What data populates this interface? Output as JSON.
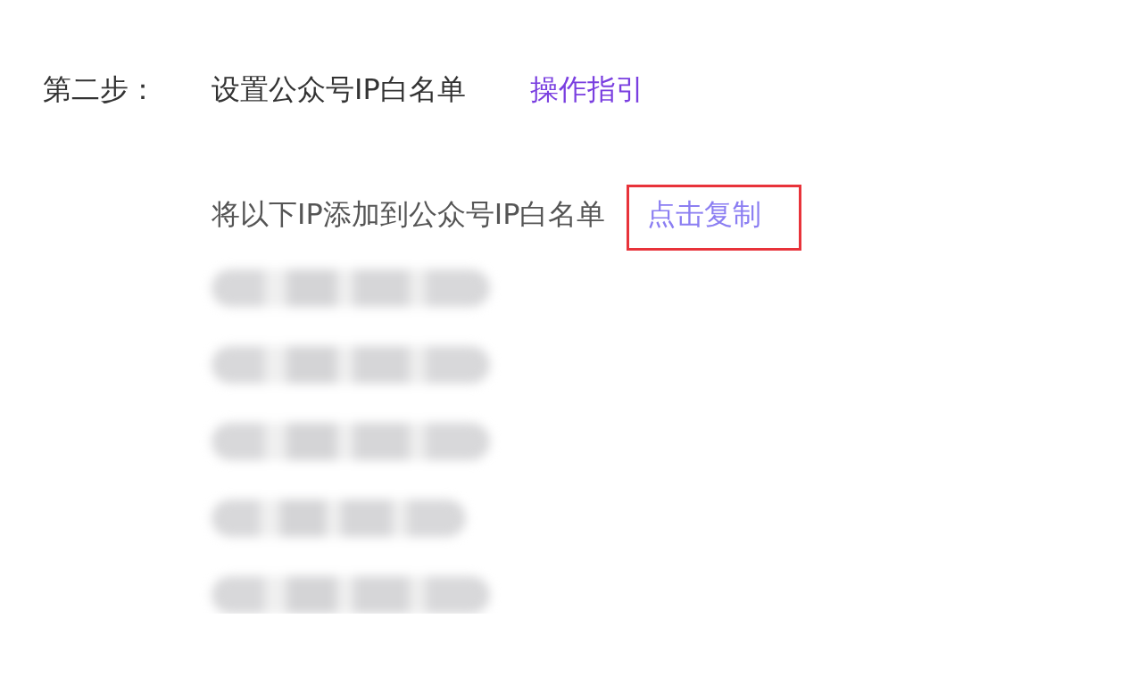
{
  "step": {
    "label": "第二步：",
    "title": "设置公众号IP白名单",
    "guide_link": "操作指引"
  },
  "instruction": {
    "text": "将以下IP添加到公众号IP白名单",
    "copy_link": "点击复制",
    "highlighted": true
  },
  "ip_list": [
    {
      "kind": "blurred"
    },
    {
      "kind": "blurred"
    },
    {
      "kind": "blurred"
    },
    {
      "kind": "blurred"
    },
    {
      "kind": "blurred"
    }
  ]
}
